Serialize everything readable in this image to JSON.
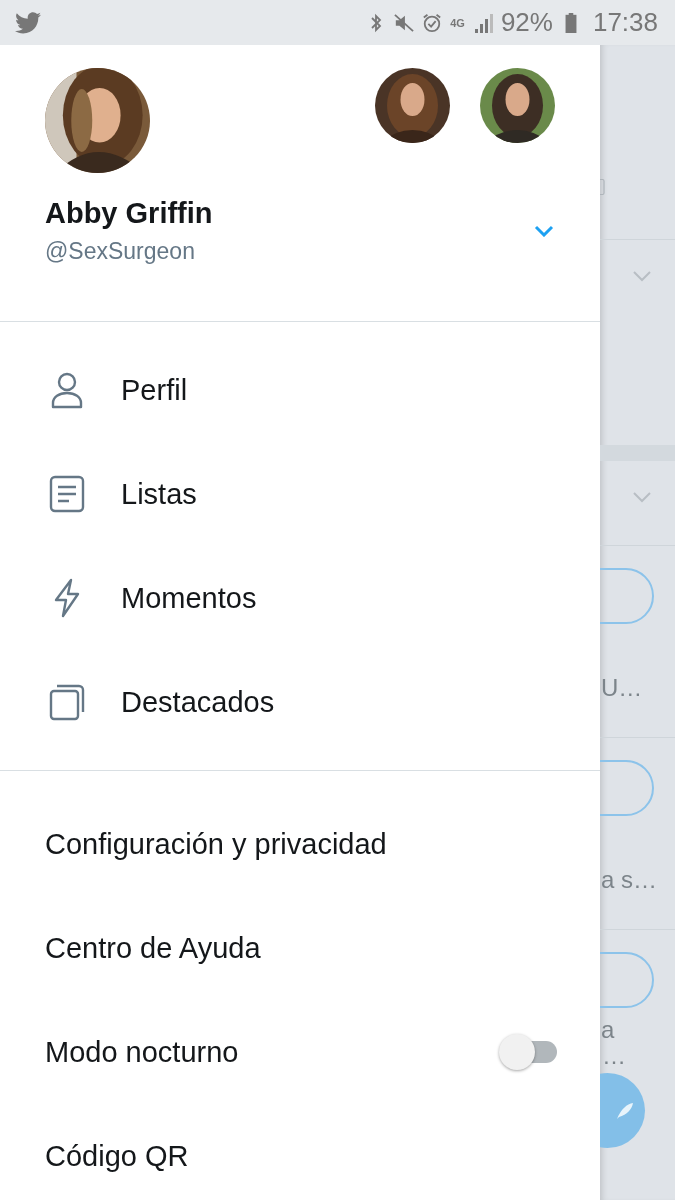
{
  "status_bar": {
    "network": "4G",
    "battery": "92%",
    "time": "17:38"
  },
  "account": {
    "name": "Abby Griffin",
    "handle": "@SexSurgeon"
  },
  "menu": [
    {
      "label": "Perfil",
      "kind": "profile"
    },
    {
      "label": "Listas",
      "kind": "lists"
    },
    {
      "label": "Momentos",
      "kind": "moments"
    },
    {
      "label": "Destacados",
      "kind": "highlights"
    }
  ],
  "settings": [
    {
      "label": "Configuración y privacidad",
      "kind": "link"
    },
    {
      "label": "Centro de Ayuda",
      "kind": "link"
    },
    {
      "label": "Modo nocturno",
      "kind": "toggle",
      "on": false
    },
    {
      "label": "Código QR",
      "kind": "link"
    }
  ],
  "background_feed": {
    "snippets": [
      "U…",
      "a s…",
      "a",
      "…"
    ]
  }
}
